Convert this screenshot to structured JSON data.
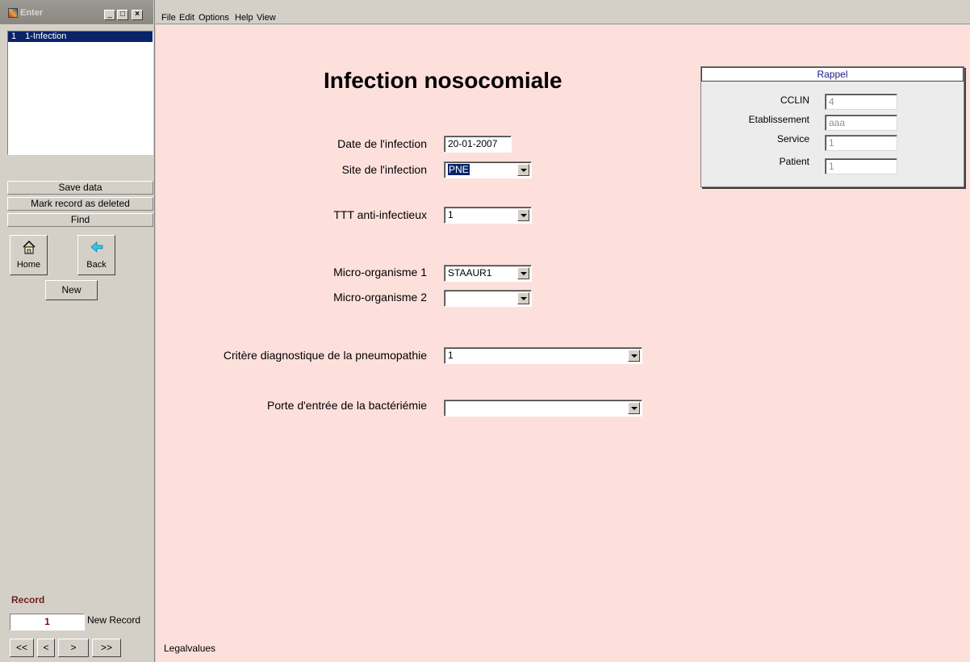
{
  "window": {
    "title": "Enter",
    "min_glyph": "_",
    "max_glyph": "□",
    "close_glyph": "×"
  },
  "record_list": {
    "items": [
      {
        "num": "1",
        "label": "1-Infection"
      }
    ]
  },
  "side_buttons": {
    "save": "Save data",
    "mark_deleted": "Mark record as deleted",
    "find": "Find",
    "home": "Home",
    "back": "Back",
    "new": "New"
  },
  "record": {
    "label": "Record",
    "number": "1",
    "status": "New Record",
    "nav": {
      "first": "<<",
      "prev": "<",
      "next": ">",
      "last": ">>"
    }
  },
  "menu": {
    "file": "File",
    "edit": "Edit",
    "options": "Options",
    "help": "Help",
    "view": "View"
  },
  "form": {
    "title": "Infection nosocomiale",
    "fields": {
      "date_label": "Date de l'infection",
      "date_value": "20-01-2007",
      "site_label": "Site de l'infection",
      "site_value": "PNE",
      "ttt_label": "TTT anti-infectieux",
      "ttt_value": "1",
      "micro1_label": "Micro-organisme 1",
      "micro1_value": "STAAUR1",
      "micro2_label": "Micro-organisme 2",
      "micro2_value": "",
      "critere_label": "Critère diagnostique de la pneumopathie",
      "critere_value": "1",
      "porte_label": "Porte d'entrée de la bactériémie",
      "porte_value": ""
    }
  },
  "rappel": {
    "title": "Rappel",
    "cclin_label": "CCLIN",
    "cclin_value": "4",
    "etab_label": "Etablissement",
    "etab_value": "aaa",
    "service_label": "Service",
    "service_value": "1",
    "patient_label": "Patient",
    "patient_value": "1"
  },
  "status_text": "Legalvalues",
  "colors": {
    "form_background": "#fde0dc",
    "selection": "#0a246a",
    "record_number": "#7a1010",
    "rappel_title_text": "#1a1a8a"
  }
}
